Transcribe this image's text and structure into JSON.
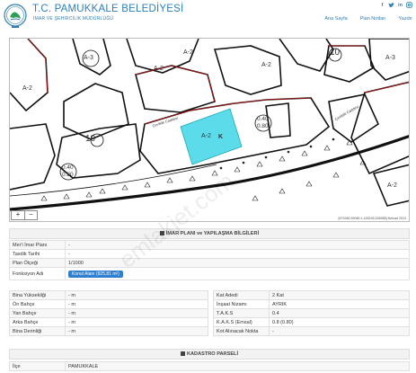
{
  "header": {
    "title": "T.C. PAMUKKALE BELEDİYESİ",
    "subtitle": "İMAR VE ŞEHİRCİLİK MÜDÜRLÜĞÜ",
    "nav": [
      "Ana Sayfa",
      "Plan Notları",
      "Yazdır"
    ],
    "social": [
      "facebook-icon",
      "twitter-icon",
      "linkedin-icon",
      "instagram-icon"
    ]
  },
  "map": {
    "zoom_in": "+",
    "zoom_out": "−",
    "coords": "[679280,99080:1-426245,536988] Netcad 2023",
    "labels": {
      "a1": "A-3",
      "a2": "A-2",
      "a3": "A-2",
      "a4": "A-2",
      "a5": "A-2",
      "a6": "A-2",
      "a7": "A-3",
      "a8": "A-2",
      "n10a": "10",
      "n10b": "10",
      "k": "K",
      "r1": "0.40",
      "r2": "0.80",
      "r3": "0.40",
      "r4": "0.80",
      "street1": "Çeviklik Caddesi",
      "street2": "Çeviklik Caddesi"
    },
    "highlight_color": "#3fd6e6"
  },
  "imar": {
    "title": "İMAR PLANI ve YAPILAŞMA BİLGİLERİ",
    "rows": [
      {
        "label": "Mer'i İmar Planı",
        "value": "-"
      },
      {
        "label": "Tasdik Tarihi",
        "value": "-"
      },
      {
        "label": "Plan Ölçeği",
        "value": "1/1000"
      },
      {
        "label": "Fonksiyon Adı",
        "value": "Konut Alanı (925,81 m²)"
      }
    ]
  },
  "yapilasma": {
    "left": [
      {
        "label": "Bina Yüksekliği",
        "value": "- m"
      },
      {
        "label": "Ön Bahçe",
        "value": "- m"
      },
      {
        "label": "Yan Bahçe",
        "value": "- m"
      },
      {
        "label": "Arka Bahçe",
        "value": "- m"
      },
      {
        "label": "Bina Derinliği",
        "value": "- m"
      }
    ],
    "right": [
      {
        "label": "Kat Adedi",
        "value": "2 Kat"
      },
      {
        "label": "İnşaat Nizamı",
        "value": "AYRIK"
      },
      {
        "label": "T.A.K.S",
        "value": "0.4"
      },
      {
        "label": "K.A.K.S (Emsal)",
        "value": "0.8 (0.80)"
      },
      {
        "label": "Kot Alınacak Nokta",
        "value": "-"
      }
    ]
  },
  "kadastro": {
    "title": "KADASTRO PARSELİ",
    "rows": [
      {
        "label": "İlçe",
        "value": "PAMUKKALE"
      }
    ]
  },
  "watermark": "emlakjet.com"
}
